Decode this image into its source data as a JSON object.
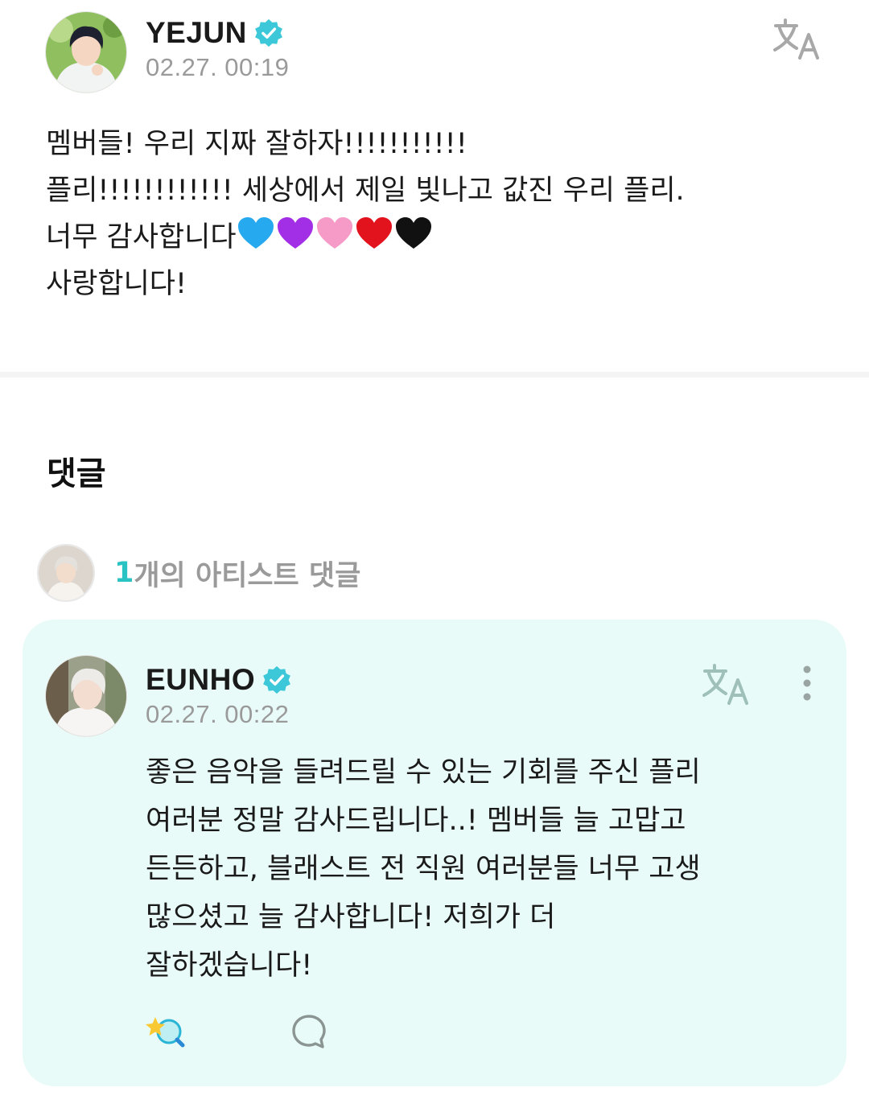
{
  "post": {
    "author": "YEJUN",
    "timestamp": "02.27. 00:19",
    "lines": [
      "멤버들! 우리 지짜 잘하자!!!!!!!!!!!",
      "플리!!!!!!!!!!!! 세상에서 제일 빛나고 값진 우리 플리.",
      "너무 감사합니다",
      "사랑합니다!"
    ],
    "heart_colors": [
      "#27a9f0",
      "#a22ee6",
      "#f69bc7",
      "#e3131e",
      "#111111"
    ],
    "icons": {
      "verified": "verified-badge-icon",
      "translate": "translate-icon"
    }
  },
  "comments_section": {
    "title": "댓글",
    "artist_count": "1",
    "artist_label": "개의 아티스트 댓글"
  },
  "comment": {
    "author": "EUNHO",
    "timestamp": "02.27. 00:22",
    "lines": [
      "좋은 음악을 들려드릴 수 있는 기회를 주신 플리",
      "여러분 정말 감사드립니다..! 멤버들 늘 고맙고",
      "든든하고, 블래스트 전 직원 여러분들 너무 고생",
      "많으셨고 늘 감사합니다! 저희가 더",
      "잘하겠습니다!"
    ],
    "icons": {
      "translate": "translate-icon",
      "more": "more-vertical-icon",
      "react": "reaction-icon",
      "reply": "reply-bubble-icon"
    }
  },
  "colors": {
    "accent": "#2ac3c3",
    "verified": "#3cc8d8",
    "card_bg": "#e9fbf8",
    "muted_text": "#9a9a9a"
  }
}
